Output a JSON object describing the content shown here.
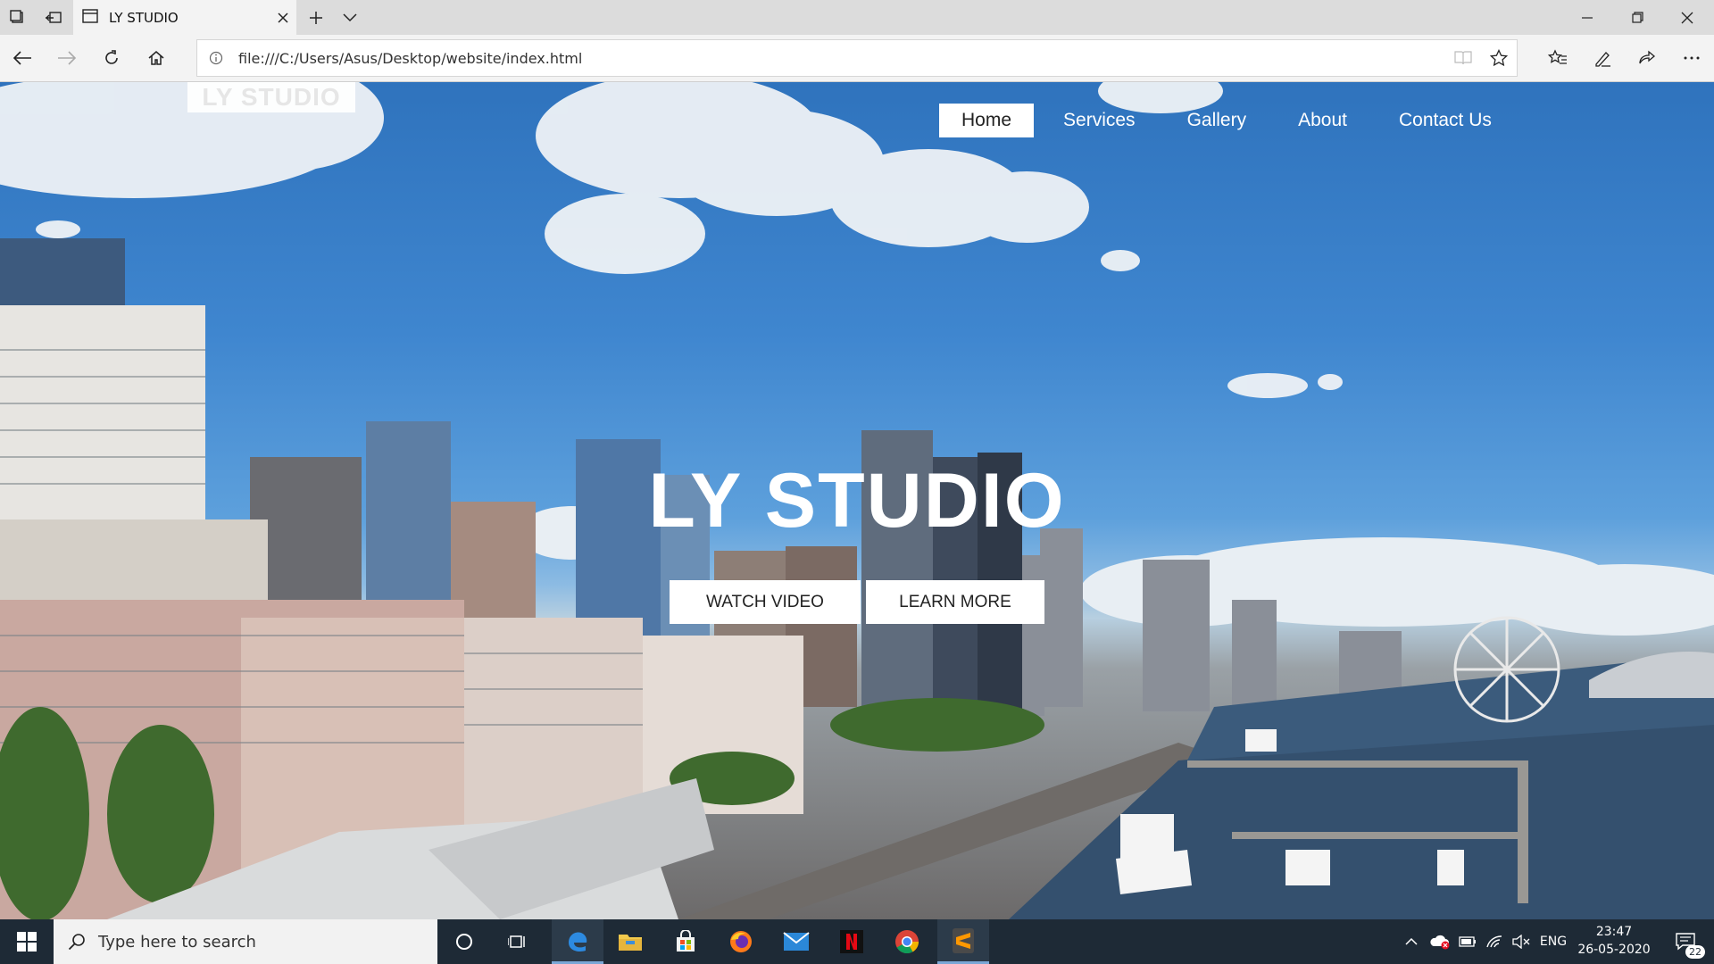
{
  "browser": {
    "tab_title": "LY STUDIO",
    "url": "file:///C:/Users/Asus/Desktop/website/index.html"
  },
  "page": {
    "logo": "LY STUDIO",
    "nav": [
      {
        "label": "Home",
        "active": true
      },
      {
        "label": "Services",
        "active": false
      },
      {
        "label": "Gallery",
        "active": false
      },
      {
        "label": "About",
        "active": false
      },
      {
        "label": "Contact Us",
        "active": false
      }
    ],
    "hero_title": "LY STUDIO",
    "buttons": {
      "watch": "WATCH VIDEO",
      "learn": "LEARN MORE"
    }
  },
  "taskbar": {
    "search_placeholder": "Type here to search",
    "language": "ENG",
    "time": "23:47",
    "date": "26-05-2020",
    "notifications": "22"
  },
  "colors": {
    "sky_top": "#2f73bd",
    "taskbar": "#1e2a36",
    "chrome": "#dcdcdc"
  }
}
